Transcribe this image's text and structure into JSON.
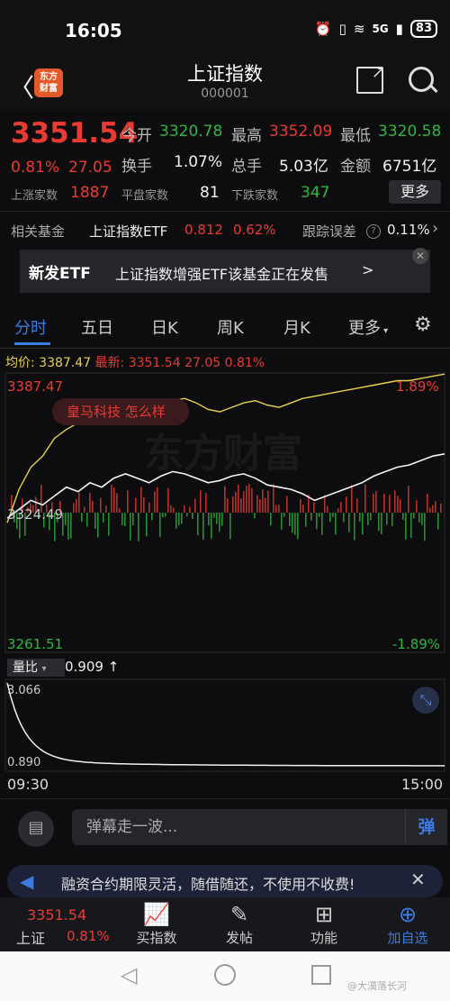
{
  "status": {
    "time": "16:05",
    "battery": "83",
    "net": "5G"
  },
  "header": {
    "title": "上证指数",
    "code": "000001",
    "logo_line1": "东方",
    "logo_line2": "财富"
  },
  "quote": {
    "price": "3351.54",
    "change_pct": "0.81%",
    "change": "27.05",
    "open_label": "今开",
    "open": "3320.78",
    "high_label": "最高",
    "high": "3352.09",
    "low_label": "最低",
    "low": "3320.58",
    "turnover_label": "换手",
    "turnover": "1.07%",
    "volume_label": "总手",
    "volume": "5.03亿",
    "amount_label": "金额",
    "amount": "6751亿",
    "up_label": "上涨家数",
    "up": "1887",
    "flat_label": "平盘家数",
    "flat": "81",
    "down_label": "下跌家数",
    "down": "347",
    "more": "更多"
  },
  "fund": {
    "label": "相关基金",
    "name": "上证指数ETF",
    "price": "0.812",
    "pct": "0.62%",
    "err_label": "跟踪误差",
    "err": "0.11%"
  },
  "banner": {
    "tag": "新发ETF",
    "text": "上证指数增强ETF该基金正在发售",
    "arrow": ">"
  },
  "tabs": [
    "分时",
    "五日",
    "日K",
    "周K",
    "月K",
    "更多"
  ],
  "legend": {
    "avg_label": "均价:",
    "avg": "3387.47",
    "last_label": "最新:",
    "last": "3351.54",
    "chg": "27.05",
    "pct": "0.81%"
  },
  "chart_data": {
    "type": "line",
    "ylim": [
      3261.51,
      3387.47
    ],
    "y_top_label": "3387.47",
    "y_bottom_label": "3261.51",
    "y_mid_label": "3324.49",
    "pct_top": "1.89%",
    "pct_bottom": "-1.89%",
    "x_start": "09:30",
    "x_end": "15:00",
    "annotation": "皇马科技 怎么样",
    "series": [
      {
        "values": [
          3322,
          3326,
          3330,
          3328,
          3332,
          3336,
          3334,
          3338,
          3336,
          3340,
          3342,
          3340,
          3338,
          3341,
          3343,
          3342,
          3340,
          3338,
          3339,
          3341,
          3342,
          3340,
          3337,
          3336,
          3335,
          3333,
          3330,
          3332,
          3334,
          3336,
          3338,
          3341,
          3343,
          3345,
          3346,
          3348,
          3350,
          3351
        ]
      },
      {
        "values": [
          3320,
          3335,
          3345,
          3350,
          3358,
          3362,
          3365,
          3368,
          3370,
          3372,
          3374,
          3373,
          3370,
          3372,
          3375,
          3376,
          3374,
          3371,
          3370,
          3372,
          3374,
          3375,
          3373,
          3372,
          3374,
          3376,
          3377,
          3378,
          3379,
          3380,
          3381,
          3382,
          3383,
          3384,
          3384,
          3385,
          3386,
          3387
        ]
      }
    ]
  },
  "volume": {
    "label": "量比",
    "value": "0.909",
    "arrow": "↑",
    "max": "3.066",
    "min": "0.890"
  },
  "comment": {
    "placeholder": "弹幕走一波...",
    "button": "弹"
  },
  "promo": {
    "text": "融资合约期限灵活，随借随还，不使用不收费!"
  },
  "nav": {
    "index_price": "3351.54",
    "index_name": "上证",
    "index_pct": "0.81%",
    "buy": "买指数",
    "post": "发帖",
    "func": "功能",
    "add": "加自选"
  },
  "watermark": "东方财富",
  "credit": "@大漠落长河"
}
